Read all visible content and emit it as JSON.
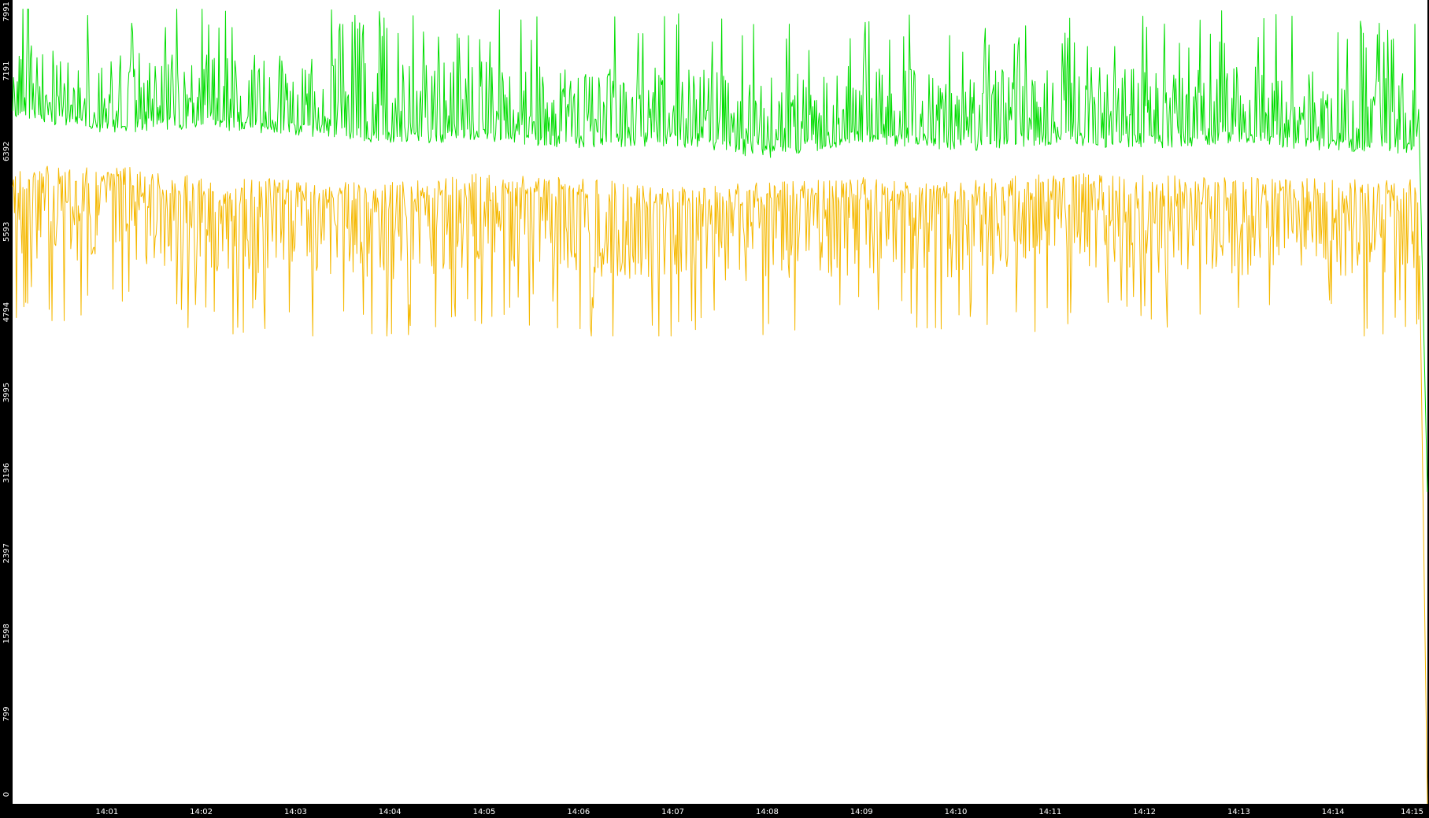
{
  "chart_data": {
    "type": "line",
    "x_range": [
      "14:00:00",
      "14:15:00"
    ],
    "x_tick_labels": [
      "14:01",
      "14:02",
      "14:03",
      "14:04",
      "14:05",
      "14:06",
      "14:07",
      "14:08",
      "14:09",
      "14:10",
      "14:11",
      "14:12",
      "14:13",
      "14:14",
      "14:15"
    ],
    "y_tick_labels": [
      "0",
      "799",
      "1598",
      "2397",
      "3196",
      "3995",
      "4794",
      "5593",
      "6392",
      "7191",
      "7991"
    ],
    "ylim": [
      0,
      7991
    ],
    "grid": false,
    "colors": {
      "background": "#ffffff",
      "axis_area": "#000000",
      "tick_text": "#ffffff",
      "series_green": "#00dd00",
      "series_yellow": "#f5b800"
    },
    "series": [
      {
        "color_key": "series_green",
        "stats": {
          "mean": 6700,
          "min": 6200,
          "max": 7900
        },
        "x": [
          "14:00:00",
          "14:01:00",
          "14:02:00",
          "14:03:00",
          "14:04:00",
          "14:05:00",
          "14:06:00",
          "14:07:00",
          "14:08:00",
          "14:09:00",
          "14:10:00",
          "14:11:00",
          "14:12:00",
          "14:13:00",
          "14:14:00",
          "14:14:55",
          "14:15:00"
        ],
        "values": [
          6950,
          6800,
          6850,
          6780,
          6700,
          6720,
          6650,
          6680,
          6550,
          6700,
          6620,
          6680,
          6650,
          6700,
          6620,
          6600,
          3100
        ]
      },
      {
        "color_key": "series_yellow",
        "stats": {
          "mean": 6000,
          "min": 4650,
          "max": 6700
        },
        "x": [
          "14:00:00",
          "14:01:00",
          "14:02:00",
          "14:03:00",
          "14:04:00",
          "14:05:00",
          "14:06:00",
          "14:07:00",
          "14:08:00",
          "14:09:00",
          "14:10:00",
          "14:11:00",
          "14:12:00",
          "14:13:00",
          "14:14:00",
          "14:14:55",
          "14:15:00"
        ],
        "values": [
          6100,
          6150,
          6000,
          5980,
          5950,
          6050,
          6000,
          5900,
          5950,
          6000,
          5950,
          6050,
          6020,
          6000,
          5980,
          6000,
          0
        ]
      }
    ]
  }
}
